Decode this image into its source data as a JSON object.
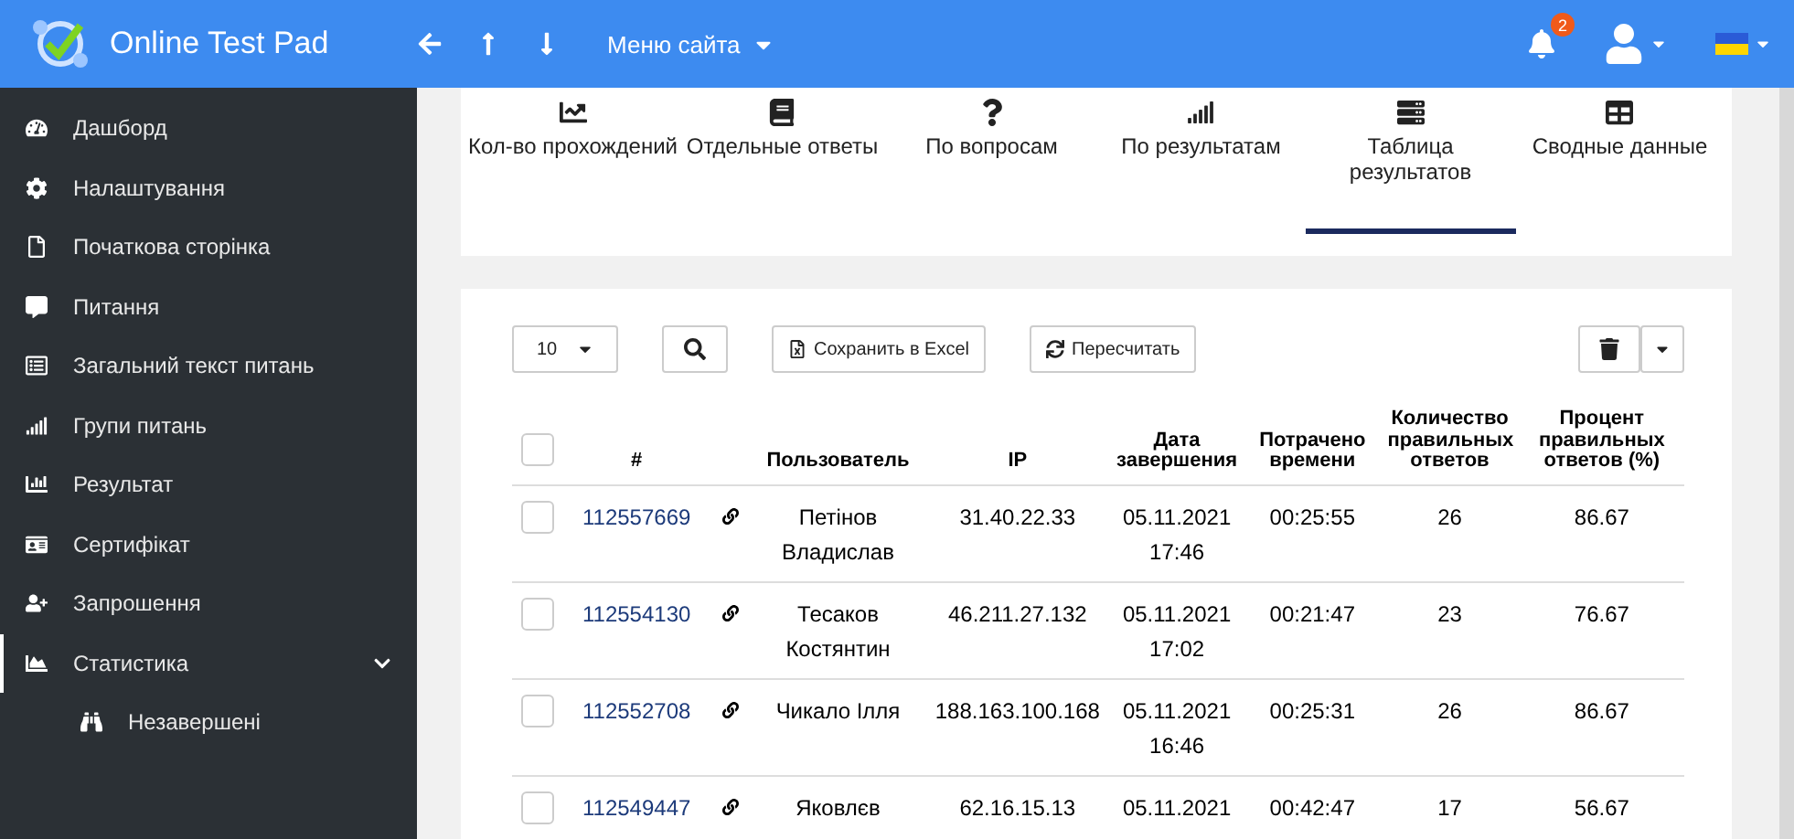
{
  "header": {
    "brand": "Online Test Pad",
    "menu": "Меню сайта",
    "notifications": "2"
  },
  "sidebar": {
    "items": [
      {
        "label": "Дашборд",
        "selected": false
      },
      {
        "label": "Налаштування",
        "selected": false
      },
      {
        "label": "Початкова сторінка",
        "selected": false
      },
      {
        "label": "Питання",
        "selected": false
      },
      {
        "label": "Загальний текст питань",
        "selected": false
      },
      {
        "label": "Групи питань",
        "selected": false
      },
      {
        "label": "Результат",
        "selected": false
      },
      {
        "label": "Сертифікат",
        "selected": false
      },
      {
        "label": "Запрошення",
        "selected": false
      },
      {
        "label": "Статистика",
        "selected": true,
        "expanded": true,
        "children": [
          {
            "label": "Незавершені",
            "selected": false
          }
        ]
      }
    ]
  },
  "tabs": [
    {
      "label": "Кол-во прохождений",
      "selected": false
    },
    {
      "label": "Отдельные ответы",
      "selected": false
    },
    {
      "label": "По вопросам",
      "selected": false
    },
    {
      "label": "По результатам",
      "selected": false
    },
    {
      "label": "Таблица результатов",
      "selected": true
    },
    {
      "label": "Сводные данные",
      "selected": false
    }
  ],
  "toolbar": {
    "page_size": "10",
    "export": "Сохранить в Excel",
    "recalc": "Пересчитать"
  },
  "table": {
    "all_checked": false,
    "columns": [
      "#",
      "Пользователь",
      "IP",
      "Дата завершения",
      "Потрачено времени",
      "Количество правильных ответов",
      "Процент правильных ответов (%)"
    ],
    "rows": [
      {
        "checked": false,
        "id": "112557669",
        "user": "Петінов Владислав",
        "ip": "31.40.22.33",
        "date": "05.11.2021 17:46",
        "time": "00:25:55",
        "correct": "26",
        "percent": "86.67"
      },
      {
        "checked": false,
        "id": "112554130",
        "user": "Тесаков Костянтин",
        "ip": "46.211.27.132",
        "date": "05.11.2021 17:02",
        "time": "00:21:47",
        "correct": "23",
        "percent": "76.67"
      },
      {
        "checked": false,
        "id": "112552708",
        "user": "Чикало Ілля",
        "ip": "188.163.100.168",
        "date": "05.11.2021 16:46",
        "time": "00:25:31",
        "correct": "26",
        "percent": "86.67"
      },
      {
        "checked": false,
        "id": "112549447",
        "user": "Яковлєв",
        "ip": "62.16.15.13",
        "date": "05.11.2021",
        "time": "00:42:47",
        "correct": "17",
        "percent": "56.67"
      }
    ]
  }
}
